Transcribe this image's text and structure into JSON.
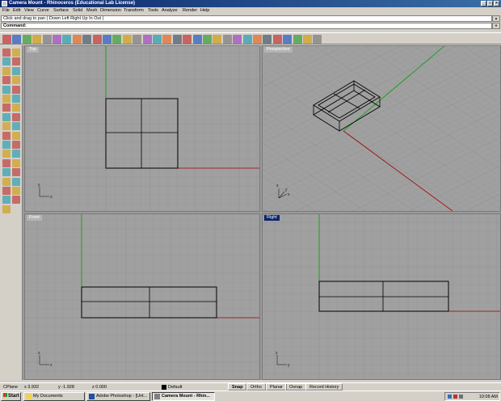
{
  "window": {
    "title": "Camera Mount - Rhinoceros (Educational Lab License)",
    "minimize_glyph": "_",
    "maximize_glyph": "□",
    "close_glyph": "×"
  },
  "menu": [
    "File",
    "Edit",
    "View",
    "Curve",
    "Surface",
    "Solid",
    "Mesh",
    "Dimension",
    "Transform",
    "Tools",
    "Analyze",
    "Render",
    "Help"
  ],
  "command": {
    "history": "Click and drag to pan ( Down  Left  Right  Up  In  Out )",
    "prompt": "Command:",
    "scroll_up_glyph": "▲",
    "scroll_down_glyph": "▼"
  },
  "viewports": {
    "top": "Top",
    "perspective": "Perspective",
    "front": "Front",
    "right": "Right"
  },
  "axis_labels": {
    "x": "x",
    "y": "y",
    "z": "z"
  },
  "colors": {
    "grid_bg": "#a0a0a0",
    "grid_minor": "#989898",
    "grid_major": "#8e8e8e",
    "x_axis": "#a00000",
    "y_axis": "#00a000",
    "geometry": "#000000"
  },
  "statusbar": {
    "cplane": "CPlane",
    "x": "x 3.932",
    "y": "y -1.928",
    "z": "z 0.000",
    "layer": "Default",
    "toggles": [
      "Snap",
      "Ortho",
      "Planar",
      "Osnap",
      "Record History"
    ]
  },
  "taskbar": {
    "start": "Start",
    "tasks": [
      "My Documents",
      "Adobe Photoshop - [Unt...",
      "Camera Mount - Rhin..."
    ],
    "clock": "10:08 AM"
  },
  "toolbar_icons": [
    "new-icon",
    "open-icon",
    "save-icon",
    "print-icon",
    "import-icon",
    "cut-icon",
    "copy-icon",
    "paste-icon",
    "undo-icon",
    "redo-icon",
    "pan-icon",
    "rotate-view-icon",
    "zoom-dynamic-icon",
    "zoom-window-icon",
    "zoom-extents-icon",
    "zoom-selected-icon",
    "zoom-all-icon",
    "undo-view-icon",
    "four-views-icon",
    "cplane-icon",
    "hide-icon",
    "light-icon",
    "lock-icon",
    "layer-icon",
    "properties-icon",
    "shade-icon",
    "render-icon",
    "render-preview-icon",
    "select-points-icon",
    "grid-snap-icon",
    "options-icon",
    "help-icon"
  ],
  "left_tool_icons": [
    "select-icon",
    "select-points-icon",
    "polyline-icon",
    "curve-icon",
    "circle-icon",
    "ellipse-icon",
    "arc-icon",
    "rectangle-icon",
    "polygon-icon",
    "freeform-icon",
    "fillet-icon",
    "offset-icon",
    "surface-icon",
    "extrude-icon",
    "loft-icon",
    "revolve-icon",
    "box-icon",
    "sphere-icon",
    "cylinder-icon",
    "boolean-icon",
    "mesh-icon",
    "join-icon",
    "explode-icon",
    "trim-icon",
    "split-icon",
    "move-icon",
    "copy-icon",
    "rotate-icon",
    "scale-icon",
    "mirror-icon",
    "array-icon",
    "group-icon",
    "dimension-icon",
    "text-icon",
    "render-icon"
  ]
}
